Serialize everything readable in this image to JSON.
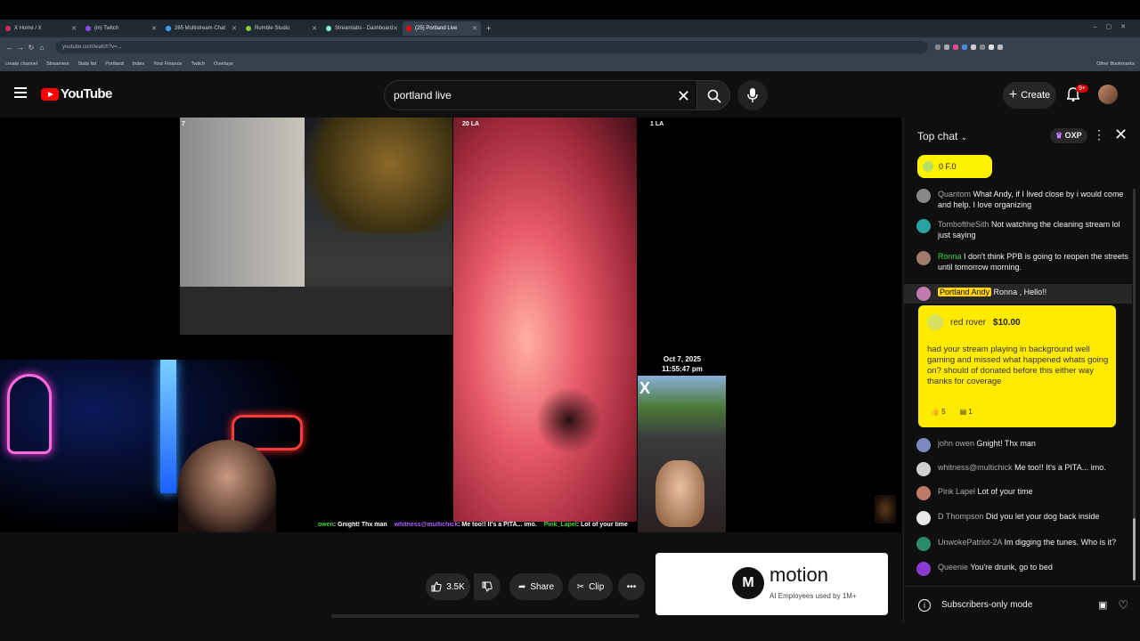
{
  "browser": {
    "tabs": [
      {
        "label": "X Home / X",
        "color": "#e0245e",
        "active": false
      },
      {
        "label": "(in) Twitch",
        "color": "#9146ff",
        "active": false
      },
      {
        "label": "265 Multistream Chat",
        "color": "#3aa0ff",
        "active": false
      },
      {
        "label": "Rumble Studio",
        "color": "#85c742",
        "active": false
      },
      {
        "label": "Streamlabs - Dashboard",
        "color": "#80f5d2",
        "active": false
      },
      {
        "label": "(25) Portland Live",
        "color": "#ff0000",
        "active": true
      }
    ],
    "url": "youtube.com/watch?v=...",
    "bookmarks": [
      "create channel",
      "Streamers",
      "Stats list",
      "Portland",
      "Index",
      "Your Finance",
      "Twitch",
      "Overlays",
      "Other Bookmarks"
    ]
  },
  "yt": {
    "search_value": "portland live",
    "create_label": "Create",
    "notif_count": "9+"
  },
  "video": {
    "panel1_label": "7",
    "panel2_label": "20 LA",
    "panel3_label": "1 LA",
    "cam_date": "Oct 7, 2025",
    "cam_time": "11:55:47 pm",
    "ticker": [
      {
        "name": "_owen",
        "text": ": Gnight! Thx man",
        "color": "#3ad63a"
      },
      {
        "name": "whitness@multichick",
        "text": ": Me too!! It's a PITA... imo.",
        "color": "#b060ff"
      },
      {
        "name": "Pink_Lapel",
        "text": ": Lot of your time",
        "color": "#3ad63a"
      }
    ]
  },
  "actions": {
    "likes": "3.5K",
    "share_label": "Share",
    "clip_label": "Clip"
  },
  "ad": {
    "brand": "motion",
    "tagline": "AI Employees used by 1M+"
  },
  "chat": {
    "title": "Top chat",
    "points": "OXP",
    "pinned_text": "0  F.0",
    "messages": [
      {
        "name": "Quantom",
        "text": "What Andy, if I lived close by i would come and help. I love organizing",
        "color": "#888888"
      },
      {
        "name": "TomboftheSith",
        "text": "Not watching the cleaning stream lol just saying",
        "color": "#2aa0a0"
      },
      {
        "name": "Ronna",
        "text": "I don't think PPB is going to reopen the streets until tomorrow morning.",
        "color": "#a07a6a",
        "name_color": "#3ad63a"
      },
      {
        "name": "Portland Andy",
        "text": "Ronna , Hello!!",
        "color": "#c07ab0",
        "owner": true
      }
    ],
    "superchat": {
      "name": "red rover",
      "amount": "$10.00",
      "text": "had your stream playing in background well gaming and missed what happened whats going on? should of donated before this either way thanks for coverage",
      "likes": "5",
      "replies": "1"
    },
    "messages2": [
      {
        "name": "john owen",
        "text": "Gnight! Thx man",
        "color": "#7a8ac0"
      },
      {
        "name": "whitness@multichick",
        "text": "Me too!! It's a PITA... imo.",
        "color": "#d0d0d0"
      },
      {
        "name": "Pink Lapel",
        "text": "Lot of your time",
        "color": "#c07a6a"
      },
      {
        "name": "D Thompson",
        "text": "Did you let your dog back inside",
        "color": "#e8e8e8"
      },
      {
        "name": "UnwokePatriot-2A",
        "text": "Im digging the tunes. Who is it?",
        "color": "#2a8a6a"
      },
      {
        "name": "Queenie",
        "text": "You're drunk, go to bed",
        "color": "#8a3ad0"
      }
    ],
    "footer_label": "Subscribers-only mode"
  }
}
